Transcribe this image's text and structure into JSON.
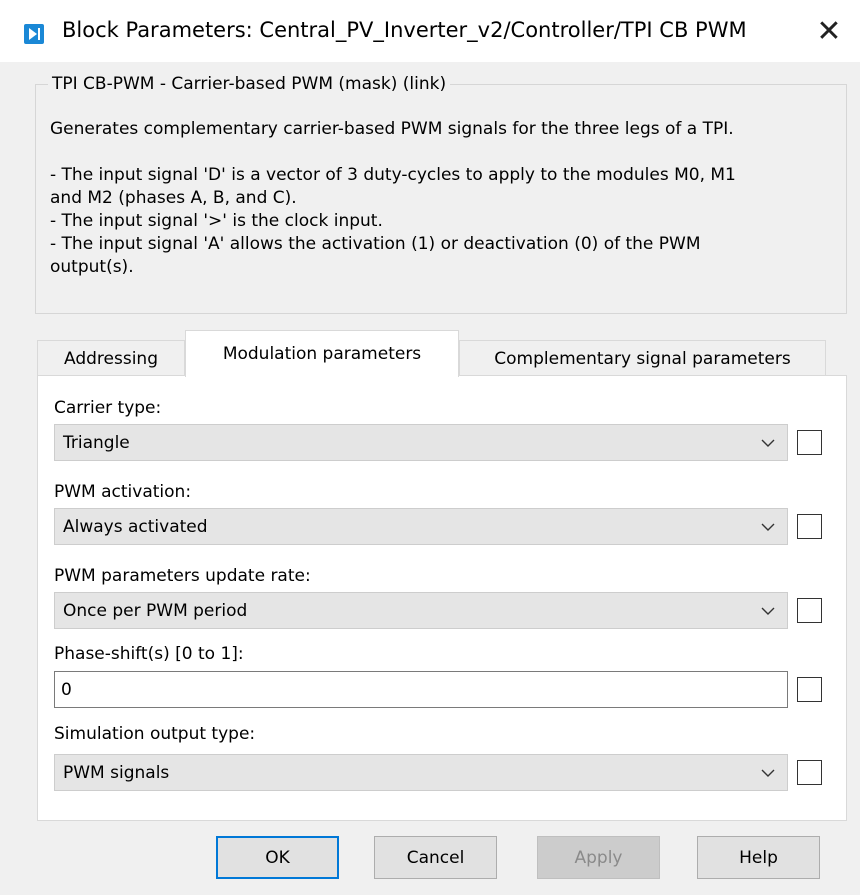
{
  "window": {
    "title": "Block Parameters: Central_PV_Inverter_v2/Controller/TPI CB PWM",
    "close_glyph": "✕"
  },
  "mask": {
    "group_title": "TPI CB-PWM - Carrier-based PWM (mask) (link)",
    "description": "Generates complementary carrier-based PWM signals for the three legs of a TPI.\n\n- The input signal 'D' is a vector of 3 duty-cycles to apply to the modules M0, M1\nand M2 (phases A, B, and C).\n- The input signal '>' is the clock input.\n- The input signal 'A' allows the activation (1) or deactivation (0) of the PWM\noutput(s)."
  },
  "tabs": [
    {
      "label": "Addressing",
      "active": false
    },
    {
      "label": "Modulation parameters",
      "active": true
    },
    {
      "label": "Complementary signal parameters",
      "active": false
    }
  ],
  "params": {
    "carrier_type": {
      "label": "Carrier type:",
      "value": "Triangle"
    },
    "pwm_activation": {
      "label": "PWM activation:",
      "value": "Always activated"
    },
    "update_rate": {
      "label": "PWM parameters update rate:",
      "value": "Once per PWM period"
    },
    "phase_shift": {
      "label": "Phase-shift(s) [0 to 1]:",
      "value": "0"
    },
    "sim_output": {
      "label": "Simulation output type:",
      "value": "PWM signals"
    }
  },
  "buttons": {
    "ok": "OK",
    "cancel": "Cancel",
    "apply": "Apply",
    "help": "Help"
  },
  "colors": {
    "accent": "#0078d7",
    "icon": "#1a88d6"
  }
}
